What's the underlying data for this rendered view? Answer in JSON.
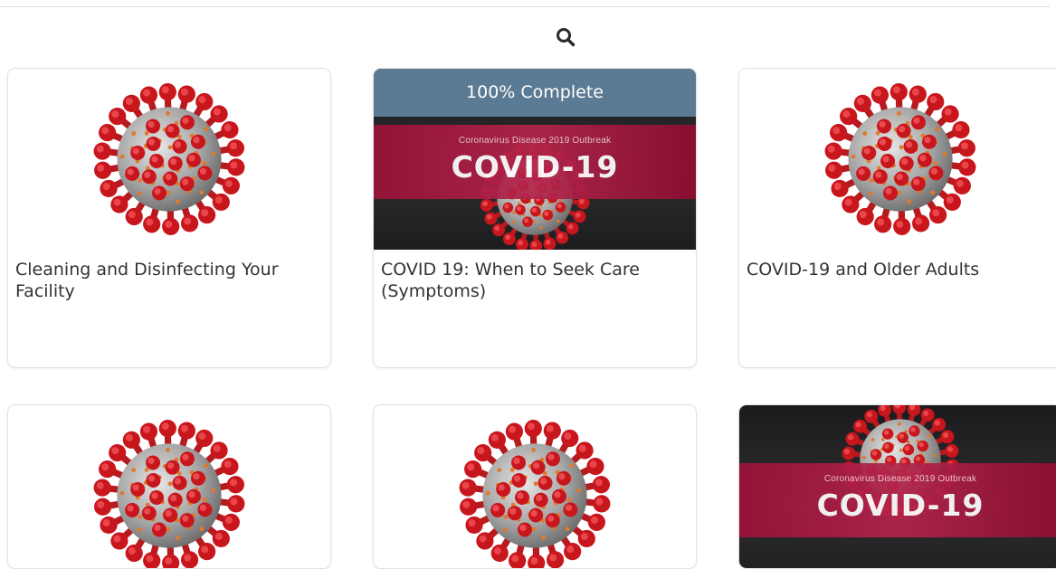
{
  "search": {
    "icon": "search-icon"
  },
  "courses": [
    {
      "title": "Cleaning and Disinfecting Your Facility",
      "image": "virus-icon"
    },
    {
      "title": "COVID 19: When to Seek Care (Symptoms)",
      "image": "covid-banner",
      "progress_label": "100% Complete",
      "progress_value": 100,
      "banner_sub": "Coronavirus Disease 2019 Outbreak",
      "banner_title": "COVID-19"
    },
    {
      "title": "COVID-19 and Older Adults",
      "image": "virus-icon"
    },
    {
      "title": "",
      "image": "virus-icon"
    },
    {
      "title": "",
      "image": "virus-icon"
    },
    {
      "title": "",
      "image": "covid-banner",
      "banner_sub": "Coronavirus Disease 2019 Outbreak",
      "banner_title": "COVID-19"
    }
  ],
  "colors": {
    "progress_bar": "#5b7a94",
    "banner": "#b3254b",
    "virus_spike": "#c8161d",
    "virus_body": "#a8a8a8"
  }
}
